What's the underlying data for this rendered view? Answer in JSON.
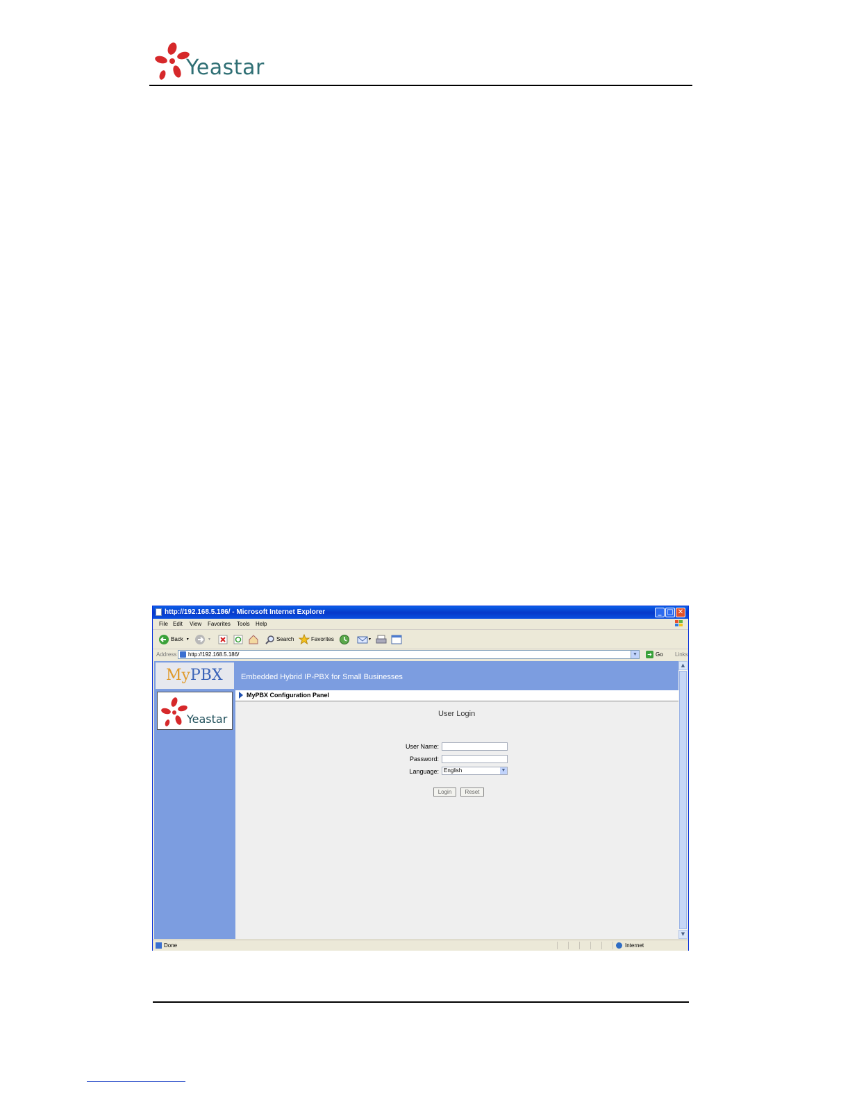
{
  "document": {
    "logo_text": "Yeastar"
  },
  "browser": {
    "title": "http://192.168.5.186/ - Microsoft Internet Explorer",
    "menu": [
      "File",
      "Edit",
      "View",
      "Favorites",
      "Tools",
      "Help"
    ],
    "toolbar": {
      "back": "Back",
      "search": "Search",
      "favorites": "Favorites"
    },
    "address": {
      "label": "Address",
      "url": "http://192.168.5.186/",
      "go": "Go",
      "links": "Links"
    },
    "status": {
      "text": "Done",
      "zone": "Internet"
    }
  },
  "page": {
    "logo_my": "My",
    "logo_pbx": "PBX",
    "banner": "Embedded Hybrid IP-PBX for Small Businesses",
    "sidebar_logo": "Yeastar",
    "panel_title": "MyPBX Configuration Panel",
    "login": {
      "title": "User Login",
      "username_label": "User Name:",
      "password_label": "Password:",
      "language_label": "Language:",
      "username_value": "",
      "password_value": "",
      "language_value": "English",
      "login_button": "Login",
      "reset_button": "Reset"
    }
  },
  "colors": {
    "banner": "#7c9de0",
    "title_bar": "#0a5fe8",
    "logo_red": "#d6282a"
  }
}
